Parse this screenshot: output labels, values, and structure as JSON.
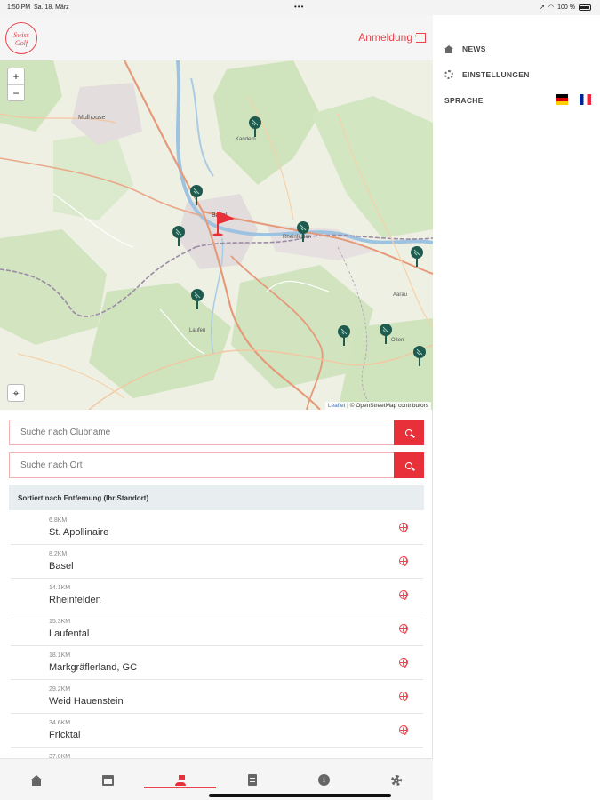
{
  "status_bar": {
    "time": "1:50 PM",
    "date": "Sa. 18. März",
    "battery": "100 %"
  },
  "header": {
    "logo_line1": "Swiss",
    "logo_line2": "Golf",
    "login_label": "Anmeldung"
  },
  "map": {
    "zoom_in": "+",
    "zoom_out": "−",
    "attribution_leaflet": "Leaflet",
    "attribution_osm": "| © OpenStreetMap contributors",
    "place_labels": [
      "Mulhouse",
      "Kandern",
      "Basel",
      "Rheinfelden",
      "Laufen",
      "Aarau",
      "Olten"
    ]
  },
  "search": {
    "club_placeholder": "Suche nach Clubname",
    "place_placeholder": "Suche nach Ort"
  },
  "sort_label": "Sortiert nach Entfernung (Ihr Standort)",
  "clubs": [
    {
      "distance": "6.8KM",
      "name": "St. Apollinaire"
    },
    {
      "distance": "8.2KM",
      "name": "Basel"
    },
    {
      "distance": "14.1KM",
      "name": "Rheinfelden"
    },
    {
      "distance": "15.3KM",
      "name": "Laufental"
    },
    {
      "distance": "18.1KM",
      "name": "Markgräflerland, GC"
    },
    {
      "distance": "29.2KM",
      "name": "Weid Hauenstein"
    },
    {
      "distance": "34.6KM",
      "name": "Fricktal"
    },
    {
      "distance": "37.0KM",
      "name": ""
    }
  ],
  "side_menu": {
    "news": "NEWS",
    "settings": "EINSTELLUNGEN",
    "language": "SPRACHE"
  },
  "colors": {
    "accent": "#e8454c",
    "button_red": "#e8303a",
    "marker_green": "#1f5a4e"
  }
}
